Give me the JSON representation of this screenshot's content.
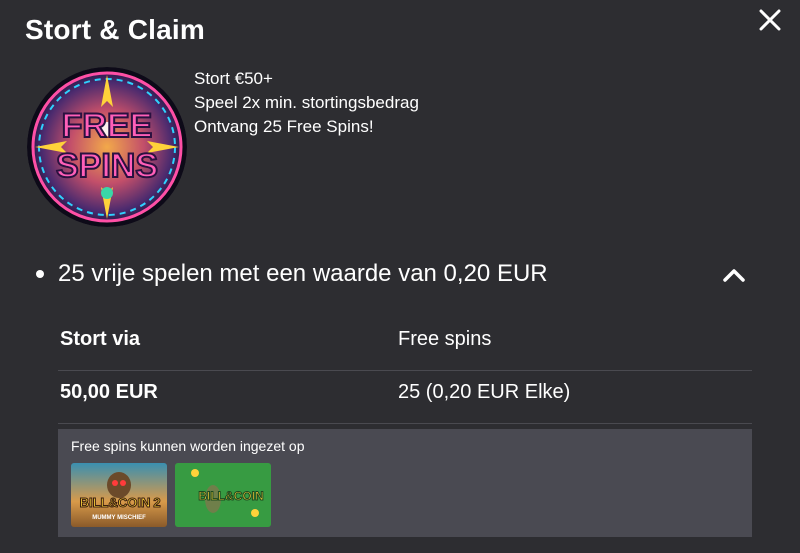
{
  "modal": {
    "title": "Stort & Claim",
    "close_icon": "close-icon",
    "badge": {
      "text_top": "FREE",
      "text_bottom": "SPINS",
      "icon": "free-spins-badge"
    },
    "promo_lines": [
      "Stort €50+",
      "Speel 2x min. stortingsbedrag",
      "Ontvang 25 Free Spins!"
    ]
  },
  "offer": {
    "heading": "25 vrije spelen met een waarde van 0,20 EUR",
    "expanded_icon": "chevron-up-icon",
    "table": {
      "headers": [
        "Stort via",
        "Free spins"
      ],
      "rows": [
        [
          "50,00 EUR",
          "25 (0,20 EUR Elke)"
        ]
      ]
    },
    "games": {
      "title": "Free spins kunnen worden ingezet op",
      "items": [
        {
          "name": "Bill & Coin 2 Mummy Mischief",
          "logo_main": "BILL&COIN",
          "logo_num": "2",
          "logo_sub": "MUMMY MISCHIEF"
        },
        {
          "name": "Bill & Coin",
          "logo_main": "BILL&COIN"
        }
      ]
    }
  },
  "colors": {
    "background": "#2d2d31",
    "panel": "#4a4a52",
    "divider": "#4a4a50",
    "text": "#ffffff"
  }
}
